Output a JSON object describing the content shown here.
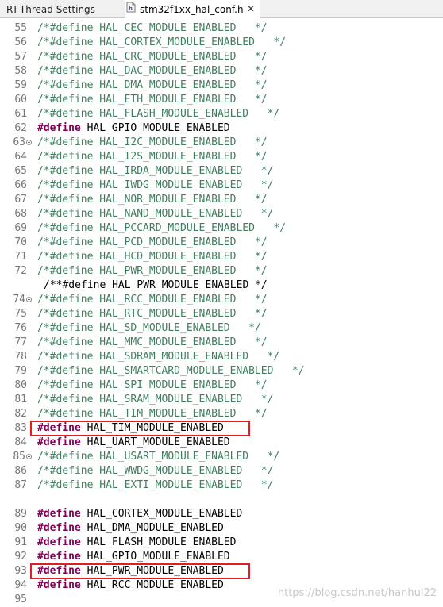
{
  "tabs": [
    {
      "label": "RT-Thread Settings",
      "icon": "settings-icon",
      "active": false
    },
    {
      "label": "stm32f1xx_hal_conf.h",
      "icon": "header-file-icon",
      "active": true,
      "close": "✕"
    }
  ],
  "colors": {
    "comment": "#3f7f5f",
    "keyword": "#7f0055",
    "highlight_box": "#e02020",
    "line_number": "#787878"
  },
  "lines": [
    {
      "num": "55",
      "type": "comment",
      "text": "/*#define HAL_CEC_MODULE_ENABLED   */"
    },
    {
      "num": "56",
      "type": "comment",
      "text": "/*#define HAL_CORTEX_MODULE_ENABLED   */"
    },
    {
      "num": "57",
      "type": "comment",
      "text": "/*#define HAL_CRC_MODULE_ENABLED   */"
    },
    {
      "num": "58",
      "type": "comment",
      "text": "/*#define HAL_DAC_MODULE_ENABLED   */"
    },
    {
      "num": "59",
      "type": "comment",
      "text": "/*#define HAL_DMA_MODULE_ENABLED   */"
    },
    {
      "num": "60",
      "type": "comment",
      "text": "/*#define HAL_ETH_MODULE_ENABLED   */"
    },
    {
      "num": "61",
      "type": "comment",
      "text": "/*#define HAL_FLASH_MODULE_ENABLED   */"
    },
    {
      "num": "62",
      "type": "define",
      "kw": "#define",
      "text": " HAL_GPIO_MODULE_ENABLED"
    },
    {
      "num": "63",
      "type": "comment",
      "fold": true,
      "text": "/*#define HAL_I2C_MODULE_ENABLED   */"
    },
    {
      "num": "64",
      "type": "comment",
      "text": "/*#define HAL_I2S_MODULE_ENABLED   */"
    },
    {
      "num": "65",
      "type": "comment",
      "text": "/*#define HAL_IRDA_MODULE_ENABLED   */"
    },
    {
      "num": "66",
      "type": "comment",
      "text": "/*#define HAL_IWDG_MODULE_ENABLED   */"
    },
    {
      "num": "67",
      "type": "comment",
      "text": "/*#define HAL_NOR_MODULE_ENABLED   */"
    },
    {
      "num": "68",
      "type": "comment",
      "text": "/*#define HAL_NAND_MODULE_ENABLED   */"
    },
    {
      "num": "69",
      "type": "comment",
      "text": "/*#define HAL_PCCARD_MODULE_ENABLED   */"
    },
    {
      "num": "70",
      "type": "comment",
      "text": "/*#define HAL_PCD_MODULE_ENABLED   */"
    },
    {
      "num": "71",
      "type": "comment",
      "text": "/*#define HAL_HCD_MODULE_ENABLED   */"
    },
    {
      "num": "72",
      "type": "comment",
      "text": "/*#define HAL_PWR_MODULE_ENABLED   */"
    },
    {
      "num": "",
      "type": "plain",
      "indent": true,
      "text": "/**#define HAL_PWR_MODULE_ENABLED */"
    },
    {
      "num": "74",
      "type": "comment",
      "fold": true,
      "text": "/*#define HAL_RCC_MODULE_ENABLED   */"
    },
    {
      "num": "75",
      "type": "comment",
      "text": "/*#define HAL_RTC_MODULE_ENABLED   */"
    },
    {
      "num": "76",
      "type": "comment",
      "text": "/*#define HAL_SD_MODULE_ENABLED   */"
    },
    {
      "num": "77",
      "type": "comment",
      "text": "/*#define HAL_MMC_MODULE_ENABLED   */"
    },
    {
      "num": "78",
      "type": "comment",
      "text": "/*#define HAL_SDRAM_MODULE_ENABLED   */"
    },
    {
      "num": "79",
      "type": "comment",
      "text": "/*#define HAL_SMARTCARD_MODULE_ENABLED   */"
    },
    {
      "num": "80",
      "type": "comment",
      "text": "/*#define HAL_SPI_MODULE_ENABLED   */"
    },
    {
      "num": "81",
      "type": "comment",
      "text": "/*#define HAL_SRAM_MODULE_ENABLED   */"
    },
    {
      "num": "82",
      "type": "comment",
      "text": "/*#define HAL_TIM_MODULE_ENABLED   */"
    },
    {
      "num": "83",
      "type": "define",
      "kw": "#define",
      "text": " HAL_TIM_MODULE_ENABLED"
    },
    {
      "num": "84",
      "type": "define",
      "kw": "#define",
      "text": " HAL_UART_MODULE_ENABLED"
    },
    {
      "num": "85",
      "type": "comment",
      "fold": true,
      "text": "/*#define HAL_USART_MODULE_ENABLED   */"
    },
    {
      "num": "86",
      "type": "comment",
      "text": "/*#define HAL_WWDG_MODULE_ENABLED   */"
    },
    {
      "num": "87",
      "type": "comment",
      "text": "/*#define HAL_EXTI_MODULE_ENABLED   */"
    },
    {
      "num": "",
      "type": "blank",
      "text": ""
    },
    {
      "num": "89",
      "type": "define",
      "kw": "#define",
      "text": " HAL_CORTEX_MODULE_ENABLED"
    },
    {
      "num": "90",
      "type": "define",
      "kw": "#define",
      "text": " HAL_DMA_MODULE_ENABLED"
    },
    {
      "num": "91",
      "type": "define",
      "kw": "#define",
      "text": " HAL_FLASH_MODULE_ENABLED"
    },
    {
      "num": "92",
      "type": "define",
      "kw": "#define",
      "text": " HAL_GPIO_MODULE_ENABLED"
    },
    {
      "num": "93",
      "type": "define",
      "kw": "#define",
      "text": " HAL_PWR_MODULE_ENABLED"
    },
    {
      "num": "94",
      "type": "define",
      "kw": "#define",
      "text": " HAL_RCC_MODULE_ENABLED"
    },
    {
      "num": "95",
      "type": "blank",
      "text": ""
    }
  ],
  "highlighted_lines": [
    "83",
    "93"
  ],
  "watermark": "https://blog.csdn.net/hanhui22"
}
